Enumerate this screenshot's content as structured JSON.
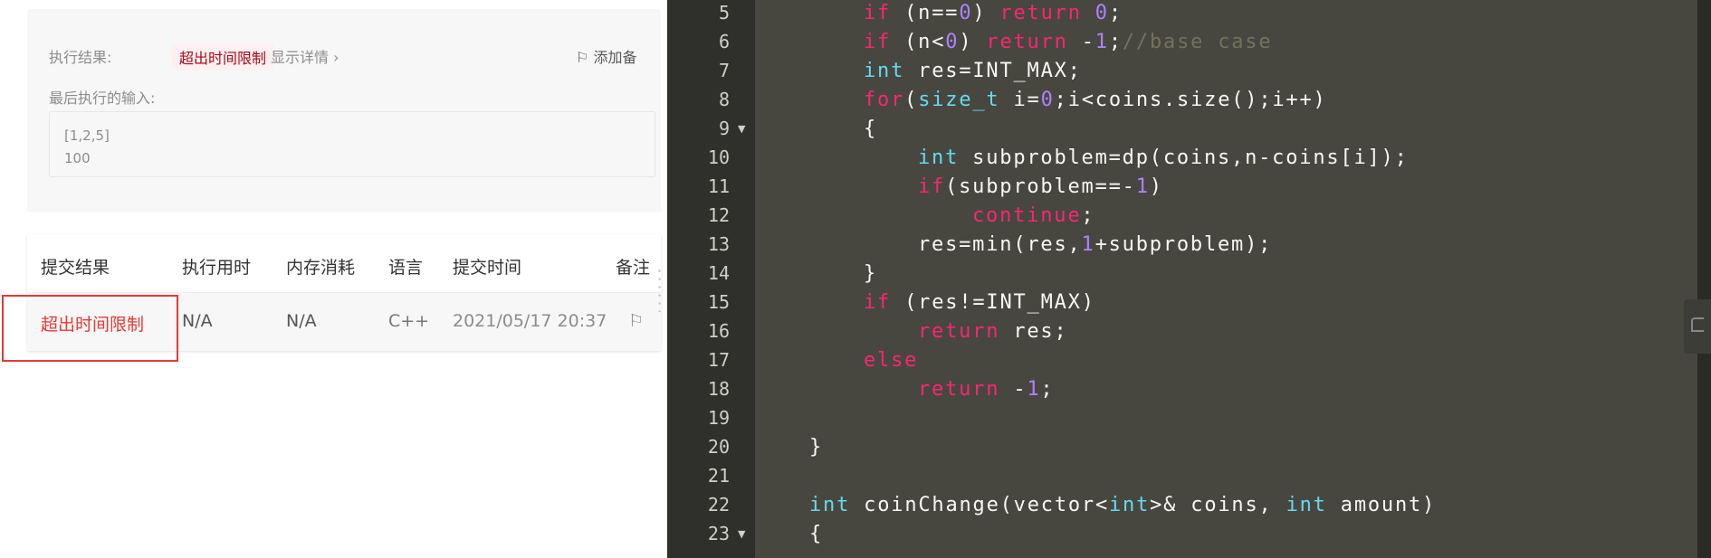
{
  "result": {
    "label": "执行结果:",
    "status": "超出时间限制",
    "details": "显示详情 ›",
    "add_note": "添加备",
    "last_input_label": "最后执行的输入:",
    "input_lines": [
      "[1,2,5]",
      "100"
    ]
  },
  "table": {
    "headers": [
      "提交结果",
      "执行用时",
      "内存消耗",
      "语言",
      "提交时间",
      "备注"
    ],
    "row": {
      "status": "超出时间限制",
      "time": "N/A",
      "memory": "N/A",
      "language": "C++",
      "submitted": "2021/05/17 20:37"
    }
  },
  "colors": {
    "keyword": "#f92672",
    "type": "#66d9ef",
    "number": "#ae81ff",
    "comment": "#75715e",
    "error": "#e53935"
  },
  "editor": {
    "lines": [
      {
        "n": "5",
        "indent": 2,
        "tokens": [
          [
            "kw",
            "if"
          ],
          [
            "pl",
            " (n=="
          ],
          [
            "nu",
            "0"
          ],
          [
            "pl",
            ") "
          ],
          [
            "kw",
            "return"
          ],
          [
            "pl",
            " "
          ],
          [
            "nu",
            "0"
          ],
          [
            "pl",
            ";"
          ]
        ]
      },
      {
        "n": "6",
        "indent": 2,
        "tokens": [
          [
            "kw",
            "if"
          ],
          [
            "pl",
            " (n<"
          ],
          [
            "nu",
            "0"
          ],
          [
            "pl",
            ") "
          ],
          [
            "kw",
            "return"
          ],
          [
            "pl",
            " -"
          ],
          [
            "nu",
            "1"
          ],
          [
            "pl",
            ";"
          ],
          [
            "cm",
            "//base case"
          ]
        ]
      },
      {
        "n": "7",
        "indent": 2,
        "tokens": [
          [
            "ty",
            "int"
          ],
          [
            "pl",
            " res=INT_MAX;"
          ]
        ]
      },
      {
        "n": "8",
        "indent": 2,
        "tokens": [
          [
            "kw",
            "for"
          ],
          [
            "pl",
            "("
          ],
          [
            "ty",
            "size_t"
          ],
          [
            "pl",
            " i="
          ],
          [
            "nu",
            "0"
          ],
          [
            "pl",
            ";i<coins.size();i++)"
          ]
        ]
      },
      {
        "n": "9",
        "fold": true,
        "indent": 2,
        "tokens": [
          [
            "pl",
            "{"
          ]
        ]
      },
      {
        "n": "10",
        "indent": 3,
        "tokens": [
          [
            "ty",
            "int"
          ],
          [
            "pl",
            " subproblem=dp(coins,n-coins[i]);"
          ]
        ]
      },
      {
        "n": "11",
        "indent": 3,
        "tokens": [
          [
            "kw",
            "if"
          ],
          [
            "pl",
            "(subproblem==-"
          ],
          [
            "nu",
            "1"
          ],
          [
            "pl",
            ")"
          ]
        ]
      },
      {
        "n": "12",
        "indent": 4,
        "tokens": [
          [
            "kw",
            "continue"
          ],
          [
            "pl",
            ";"
          ]
        ]
      },
      {
        "n": "13",
        "indent": 3,
        "tokens": [
          [
            "pl",
            "res=min(res,"
          ],
          [
            "nu",
            "1"
          ],
          [
            "pl",
            "+subproblem);"
          ]
        ]
      },
      {
        "n": "14",
        "indent": 2,
        "tokens": [
          [
            "pl",
            "}"
          ]
        ]
      },
      {
        "n": "15",
        "indent": 2,
        "tokens": [
          [
            "kw",
            "if"
          ],
          [
            "pl",
            " (res!=INT_MAX)"
          ]
        ]
      },
      {
        "n": "16",
        "indent": 3,
        "tokens": [
          [
            "kw",
            "return"
          ],
          [
            "pl",
            " res;"
          ]
        ]
      },
      {
        "n": "17",
        "indent": 2,
        "tokens": [
          [
            "kw",
            "else"
          ]
        ]
      },
      {
        "n": "18",
        "indent": 3,
        "tokens": [
          [
            "kw",
            "return"
          ],
          [
            "pl",
            " -"
          ],
          [
            "nu",
            "1"
          ],
          [
            "pl",
            ";"
          ]
        ]
      },
      {
        "n": "19",
        "indent": 0,
        "tokens": []
      },
      {
        "n": "20",
        "indent": 1,
        "tokens": [
          [
            "pl",
            "}"
          ]
        ]
      },
      {
        "n": "21",
        "indent": 0,
        "tokens": []
      },
      {
        "n": "22",
        "indent": 1,
        "tokens": [
          [
            "ty",
            "int"
          ],
          [
            "pl",
            " coinChange(vector<"
          ],
          [
            "ty",
            "int"
          ],
          [
            "pl",
            ">& coins, "
          ],
          [
            "ty",
            "int"
          ],
          [
            "pl",
            " amount)"
          ]
        ]
      },
      {
        "n": "23",
        "fold": true,
        "indent": 1,
        "tokens": [
          [
            "pl",
            "{"
          ]
        ]
      }
    ]
  }
}
